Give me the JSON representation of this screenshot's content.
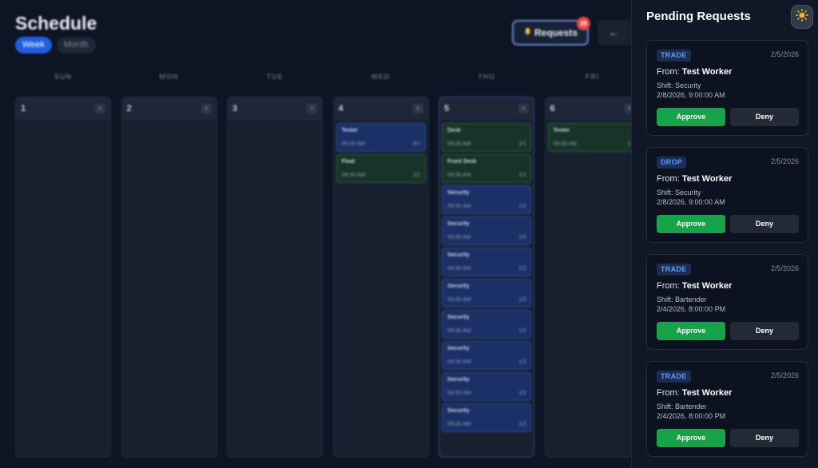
{
  "header": {
    "title": "Schedule",
    "views": [
      {
        "label": "Week",
        "active": true
      },
      {
        "label": "Month",
        "active": false
      }
    ],
    "requests_label": "Requests",
    "requests_badge": "28",
    "prev_label": "←"
  },
  "weekdays": [
    "SUN",
    "MON",
    "TUE",
    "WED",
    "THU",
    "FRI"
  ],
  "days": [
    {
      "number": "1",
      "add": "+",
      "shifts": []
    },
    {
      "number": "2",
      "add": "+",
      "shifts": []
    },
    {
      "number": "3",
      "add": "+",
      "shifts": []
    },
    {
      "number": "4",
      "add": "+",
      "shifts": [
        {
          "name": "Tester",
          "time": "09:00 AM",
          "count": "0/1",
          "color": "blue"
        },
        {
          "name": "Float",
          "time": "09:00 AM",
          "count": "1/1",
          "color": "green"
        }
      ]
    },
    {
      "number": "5",
      "add": "+",
      "today": true,
      "shifts": [
        {
          "name": "Desk",
          "time": "09:00 AM",
          "count": "1/1",
          "color": "green"
        },
        {
          "name": "Front Desk",
          "time": "09:00 AM",
          "count": "1/1",
          "color": "green"
        },
        {
          "name": "Security",
          "time": "09:00 AM",
          "count": "1/2",
          "color": "blue"
        },
        {
          "name": "Security",
          "time": "09:00 AM",
          "count": "1/2",
          "color": "blue"
        },
        {
          "name": "Security",
          "time": "09:00 AM",
          "count": "1/2",
          "color": "blue"
        },
        {
          "name": "Security",
          "time": "09:00 AM",
          "count": "1/2",
          "color": "blue"
        },
        {
          "name": "Security",
          "time": "09:00 AM",
          "count": "1/2",
          "color": "blue"
        },
        {
          "name": "Security",
          "time": "09:00 AM",
          "count": "1/2",
          "color": "blue"
        },
        {
          "name": "Security",
          "time": "09:00 AM",
          "count": "1/2",
          "color": "blue"
        },
        {
          "name": "Security",
          "time": "09:00 AM",
          "count": "1/2",
          "color": "blue"
        }
      ]
    },
    {
      "number": "6",
      "add": "+",
      "shifts": [
        {
          "name": "Tester",
          "time": "09:00 AM",
          "count": "1/",
          "color": "green"
        }
      ]
    }
  ],
  "panel": {
    "title": "Pending Requests",
    "theme_icon": "sun-icon",
    "requests": [
      {
        "type": "TRADE",
        "date": "2/5/2026",
        "from_label": "From:",
        "from_name": "Test Worker",
        "shift": "Shift: Security",
        "when": "2/8/2026, 9:00:00 AM",
        "approve": "Approve",
        "deny": "Deny"
      },
      {
        "type": "DROP",
        "date": "2/5/2026",
        "from_label": "From:",
        "from_name": "Test Worker",
        "shift": "Shift: Security",
        "when": "2/8/2026, 9:00:00 AM",
        "approve": "Approve",
        "deny": "Deny"
      },
      {
        "type": "TRADE",
        "date": "2/5/2026",
        "from_label": "From:",
        "from_name": "Test Worker",
        "shift": "Shift: Bartender",
        "when": "2/4/2026, 8:00:00 PM",
        "approve": "Approve",
        "deny": "Deny"
      },
      {
        "type": "TRADE",
        "date": "2/5/2026",
        "from_label": "From:",
        "from_name": "Test Worker",
        "shift": "Shift: Bartender",
        "when": "2/4/2026, 8:00:00 PM",
        "approve": "Approve",
        "deny": "Deny"
      }
    ]
  },
  "colors": {
    "accent": "#1f5fe0",
    "approve": "#16a34a",
    "badge": "#e64545",
    "type_text": "#5b9bff"
  }
}
